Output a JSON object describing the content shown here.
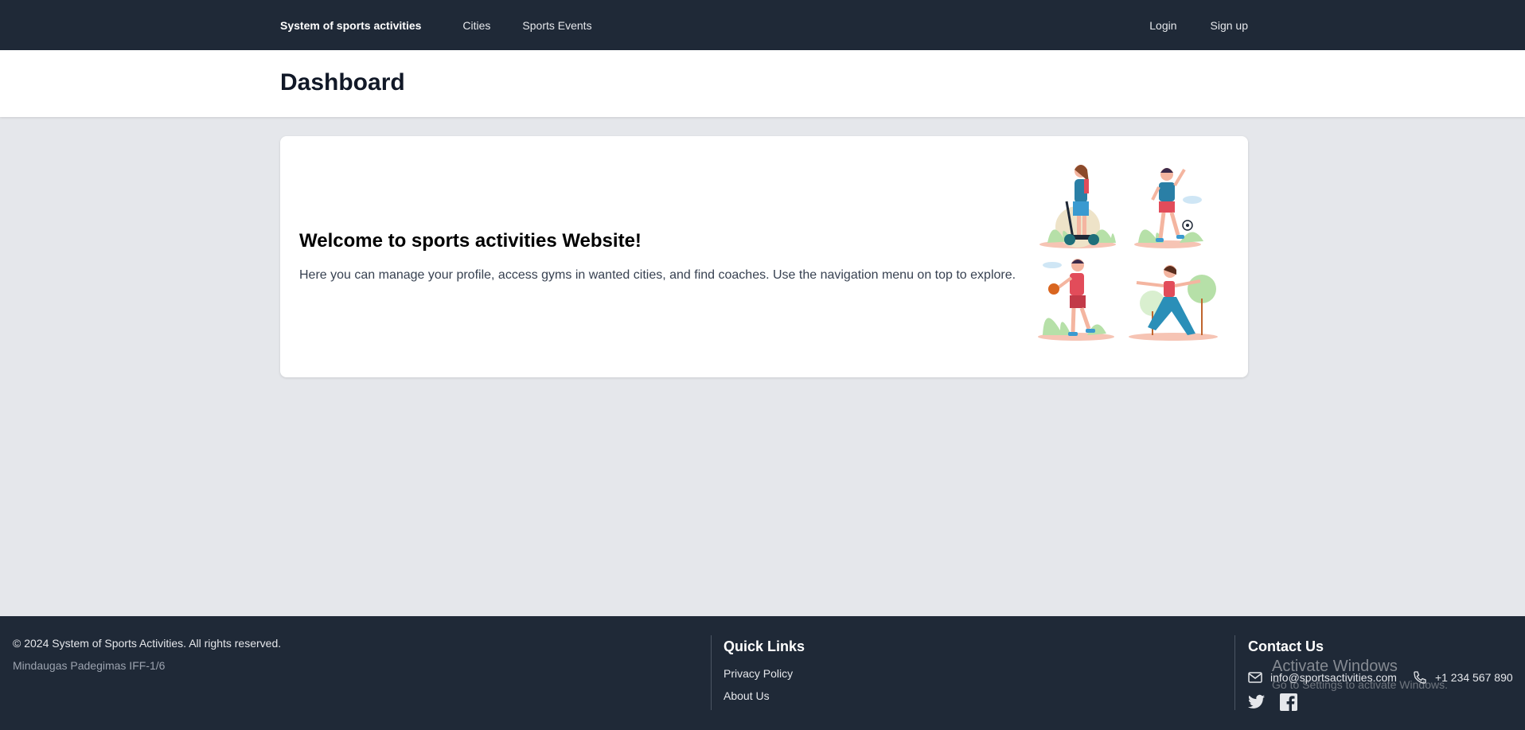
{
  "navbar": {
    "brand": "System of sports activities",
    "links": [
      "Cities",
      "Sports Events"
    ],
    "login": "Login",
    "signup": "Sign up"
  },
  "header": {
    "title": "Dashboard"
  },
  "welcome": {
    "title": "Welcome to sports activities Website!",
    "description": "Here you can manage your profile, access gyms in wanted cities, and find coaches. Use the navigation menu on top to explore."
  },
  "footer": {
    "copyright": "© 2024 System of Sports Activities. All rights reserved.",
    "author": "Mindaugas Padegimas IFF-1/6",
    "quick_links": {
      "heading": "Quick Links",
      "items": [
        "Privacy Policy",
        "About Us"
      ]
    },
    "contact": {
      "heading": "Contact Us",
      "email": "info@sportsactivities.com",
      "phone": "+1 234 567 890"
    }
  },
  "watermark": {
    "title": "Activate Windows",
    "subtitle": "Go to Settings to activate Windows."
  },
  "colors": {
    "dark": "#1f2937",
    "background": "#e5e7eb"
  }
}
